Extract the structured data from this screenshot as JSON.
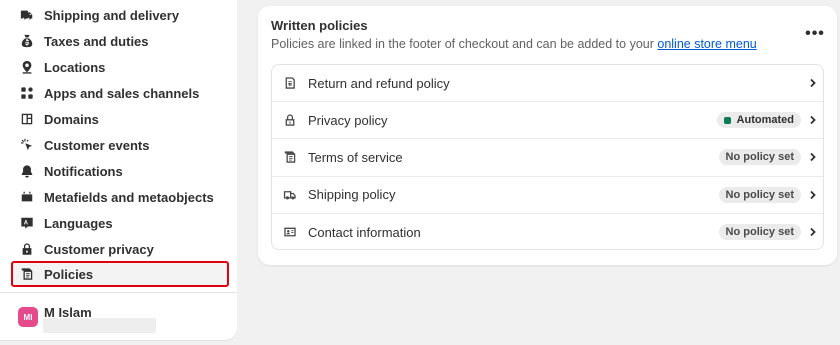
{
  "sidebar": {
    "items": [
      {
        "label": "Shipping and delivery",
        "icon": "truck-icon"
      },
      {
        "label": "Taxes and duties",
        "icon": "tax-bag-icon"
      },
      {
        "label": "Locations",
        "icon": "location-pin-icon"
      },
      {
        "label": "Apps and sales channels",
        "icon": "apps-grid-icon"
      },
      {
        "label": "Domains",
        "icon": "globe-icon"
      },
      {
        "label": "Customer events",
        "icon": "cursor-click-icon"
      },
      {
        "label": "Notifications",
        "icon": "bell-icon"
      },
      {
        "label": "Metafields and metaobjects",
        "icon": "metafields-icon"
      },
      {
        "label": "Languages",
        "icon": "language-icon"
      },
      {
        "label": "Customer privacy",
        "icon": "lock-icon"
      },
      {
        "label": "Policies",
        "icon": "policy-document-icon",
        "active": true
      }
    ],
    "user": {
      "initials": "MI",
      "name": "M Islam",
      "avatar_color": "#e54a8c"
    }
  },
  "card": {
    "title": "Written policies",
    "description": "Policies are linked in the footer of checkout and can be added to your",
    "link_text": "online store menu",
    "more_label": "•••",
    "policies": [
      {
        "label": "Return and refund policy",
        "icon": "refund-icon",
        "status": ""
      },
      {
        "label": "Privacy policy",
        "icon": "lock-icon",
        "status": "Automated",
        "status_type": "success"
      },
      {
        "label": "Terms of service",
        "icon": "document-icon",
        "status": "No policy set"
      },
      {
        "label": "Shipping policy",
        "icon": "truck-icon",
        "status": "No policy set"
      },
      {
        "label": "Contact information",
        "icon": "contact-card-icon",
        "status": "No policy set"
      }
    ]
  },
  "colors": {
    "accent_link": "#005bd3",
    "active_outline": "#e00010",
    "automated_dot": "#0a7c55"
  }
}
